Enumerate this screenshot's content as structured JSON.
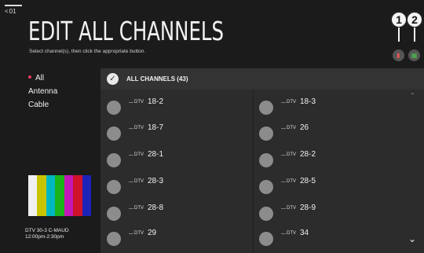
{
  "header": {
    "back_label": "01",
    "title": "EDIT ALL CHANNELS",
    "subtitle": "Select channel(s), then click the appropriate button."
  },
  "callouts": [
    "1",
    "2"
  ],
  "buttons": [
    {
      "icon": "lock-icon",
      "color": "#e0554f"
    },
    {
      "icon": "unlock-icon",
      "color": "#49c24d"
    }
  ],
  "sidebar": {
    "items": [
      {
        "label": "All",
        "selected": true
      },
      {
        "label": "Antenna",
        "selected": false
      },
      {
        "label": "Cable",
        "selected": false
      }
    ]
  },
  "preview": {
    "bar_colors": [
      "#f0f0f0",
      "#c9c400",
      "#00b7c2",
      "#19b319",
      "#c418b6",
      "#d0122a",
      "#1d22b8"
    ],
    "channel": "DTV 30-3 C-MAUD",
    "time": "12:00pm-2:30pm"
  },
  "list": {
    "all_label": "ALL CHANNELS (43)",
    "type_label": "DTV",
    "channels": [
      "18-2",
      "18-3",
      "18-7",
      "26",
      "28-1",
      "28-2",
      "28-3",
      "28-5",
      "28-8",
      "28-9",
      "29",
      "34"
    ]
  }
}
